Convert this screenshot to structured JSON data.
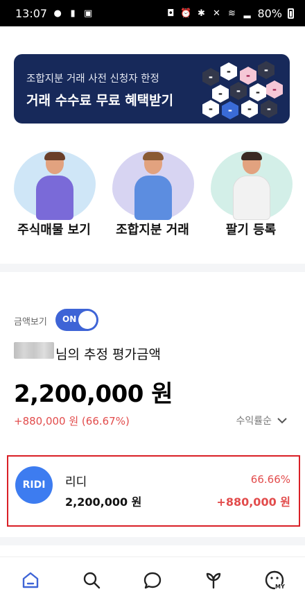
{
  "status_bar": {
    "time": "13:07",
    "battery": "80%"
  },
  "banner": {
    "subtitle": "조합지분 거래 사전 신청자 한정",
    "title": "거래 수수료 무료 혜택받기"
  },
  "categories": [
    {
      "label": "주식매물 보기"
    },
    {
      "label": "조합지분 거래"
    },
    {
      "label": "팔기 등록"
    }
  ],
  "portfolio": {
    "toggle_label": "금액보기",
    "toggle_state": "ON",
    "estimate_title": "님의 추정 평가금액",
    "total_amount": "2,200,000 원",
    "total_change": "+880,000 원 (66.67%)",
    "sort_label": "수익률순"
  },
  "holdings": [
    {
      "logo_text": "RIDI",
      "name": "리디",
      "value": "2,200,000 원",
      "percent": "66.66%",
      "change": "+880,000 원"
    }
  ],
  "bottom_nav": [
    {
      "icon": "home-icon"
    },
    {
      "icon": "search-icon"
    },
    {
      "icon": "chat-icon"
    },
    {
      "icon": "sprout-icon"
    },
    {
      "icon": "my-icon",
      "label": "MY"
    }
  ],
  "colors": {
    "accent": "#3e64d6",
    "banner_bg": "#17295a",
    "gain": "#e24c4c",
    "highlight_border": "#d91f26"
  }
}
